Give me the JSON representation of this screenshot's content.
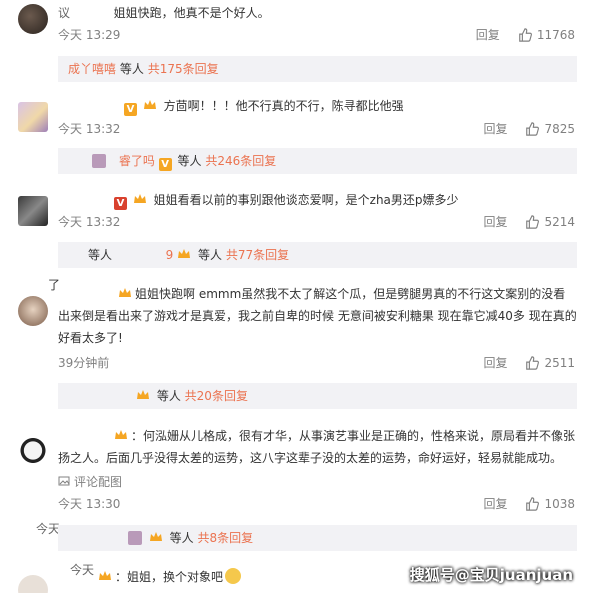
{
  "comments": [
    {
      "user": "议",
      "text": "姐姐快跑，他真不是个好人。",
      "time": "今天 13:29",
      "reply_label": "回复",
      "likes": "11768",
      "replies": {
        "name": "成丫嘻嘻",
        "mid": "等人",
        "count": "共175条回复"
      }
    },
    {
      "user": "",
      "text": "方茴啊！！！他不行真的不行，陈寻都比他强",
      "time": "今天 13:32",
      "reply_label": "回复",
      "likes": "7825",
      "replies": {
        "name": "了吗",
        "mid": "等人",
        "count": "共246条回复",
        "pre": "睿了吗"
      }
    },
    {
      "user": "",
      "text": "姐姐看看以前的事别跟他谈恋爱啊，是个zha男还p嫖多少",
      "time": "今天 13:32",
      "reply_label": "回复",
      "likes": "5214",
      "replies": {
        "name": "",
        "mid": "等人",
        "count": "共77条回复",
        "prefix": "等人"
      }
    },
    {
      "user": "了",
      "text_lines": [
        "姐姐快跑啊 emmm虽然我不太了解这个瓜，但是劈腿男真的不行这文案别的没看",
        "出来倒是看出来了游戏才是真爱，我之前自卑的时候 无意间被安利糖果 现在靠它减40多 现在真的",
        "好看太多了!"
      ],
      "time": "39分钟前",
      "reply_label": "回复",
      "likes": "2511",
      "replies": {
        "name": "",
        "mid": "等人",
        "count": "共20条回复"
      }
    },
    {
      "user": "",
      "text_lines": [
        "何泓姗从儿格成，很有才华，从事演艺事业是正确的，性格来说，原局看并不像张",
        "扬之人。后面几乎没得太差的运势，这八字这辈子没的太差的运势，命好运好，轻易就能成功。"
      ],
      "extra": "评论配图",
      "time": "今天 13:30",
      "reply_label": "回复",
      "likes": "1038",
      "replies": {
        "name": "",
        "mid": "等人",
        "count": "共8条回复",
        "pre": "今天"
      }
    },
    {
      "user": "",
      "pre": "今天",
      "text": "姐姐，换个对象吧"
    }
  ],
  "watermark": "搜狐号@宝贝juanjuan",
  "colors": {
    "accent": "#eb7350",
    "meta": "#808080",
    "reply_bg": "#f2f2f5"
  }
}
